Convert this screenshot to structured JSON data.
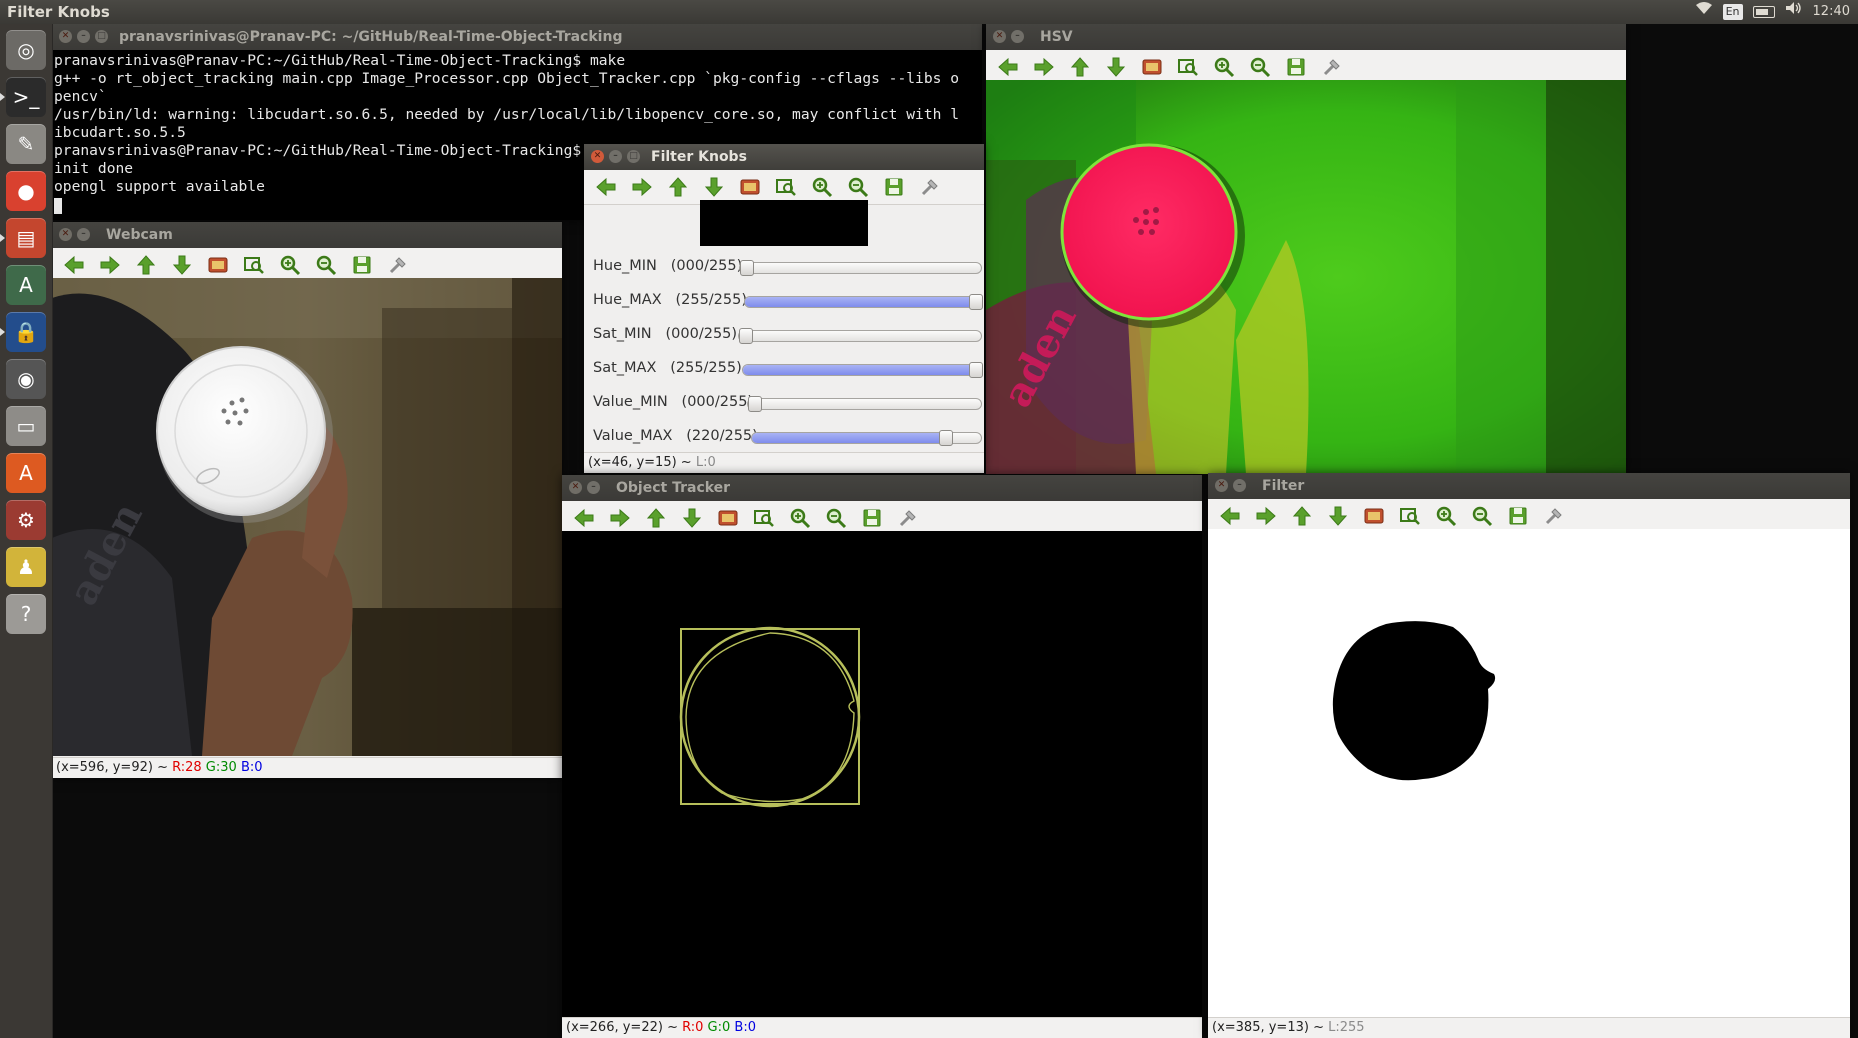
{
  "top_panel": {
    "app_title": "Filter Knobs",
    "keyboard_layout": "En",
    "clock": "12:40"
  },
  "launcher": {
    "items": [
      {
        "name": "dash-home",
        "glyph": "◎",
        "color": "#6c6a66"
      },
      {
        "name": "terminal",
        "glyph": ">_",
        "color": "#2b2b2b"
      },
      {
        "name": "text-editor",
        "glyph": "✎",
        "color": "#8a8883"
      },
      {
        "name": "chrome",
        "glyph": "●",
        "color": "#d9412f"
      },
      {
        "name": "files",
        "glyph": "▤",
        "color": "#c4462e"
      },
      {
        "name": "software-updater",
        "glyph": "A",
        "color": "#3f6a4a"
      },
      {
        "name": "lock-app",
        "glyph": "🔒",
        "color": "#234d8c"
      },
      {
        "name": "webcam-app",
        "glyph": "◉",
        "color": "#555"
      },
      {
        "name": "disk-drive",
        "glyph": "▭",
        "color": "#8e8c88"
      },
      {
        "name": "software-center",
        "glyph": "A",
        "color": "#dd5a21"
      },
      {
        "name": "system-settings",
        "glyph": "⚙",
        "color": "#9b3b32"
      },
      {
        "name": "ninja-ide",
        "glyph": "♟",
        "color": "#d2b43a"
      },
      {
        "name": "help",
        "glyph": "?",
        "color": "#9c9a96"
      }
    ]
  },
  "terminal": {
    "title": "pranavsrinivas@Pranav-PC: ~/GitHub/Real-Time-Object-Tracking",
    "lines": [
      "pranavsrinivas@Pranav-PC:~/GitHub/Real-Time-Object-Tracking$ make",
      "g++ -o rt_object_tracking main.cpp Image_Processor.cpp Object_Tracker.cpp `pkg-config --cflags --libs o",
      "pencv`",
      "/usr/bin/ld: warning: libcudart.so.6.5, needed by /usr/local/lib/libopencv_core.so, may conflict with l",
      "ibcudart.so.5.5",
      "pranavsrinivas@Pranav-PC:~/GitHub/Real-Time-Object-Tracking$ ./rt_object_tracking",
      "init done",
      "opengl support available"
    ]
  },
  "webcam": {
    "title": "Webcam",
    "status_prefix": "(x=596, y=92) ~ ",
    "r": "R:28",
    "g": "G:30",
    "b": "B:0",
    "printed_text": "aden"
  },
  "hsv": {
    "title": "HSV",
    "printed_text": "aden"
  },
  "filter_knobs": {
    "title": "Filter Knobs",
    "knobs": [
      {
        "label": "Hue_MIN",
        "display": "(000/255)",
        "value": 0,
        "max": 255
      },
      {
        "label": "Hue_MAX",
        "display": "(255/255)",
        "value": 255,
        "max": 255
      },
      {
        "label": "Sat_MIN",
        "display": "(000/255)",
        "value": 0,
        "max": 255
      },
      {
        "label": "Sat_MAX",
        "display": "(255/255)",
        "value": 255,
        "max": 255
      },
      {
        "label": "Value_MIN",
        "display": "(000/255)",
        "value": 0,
        "max": 255
      },
      {
        "label": "Value_MAX",
        "display": "(220/255)",
        "value": 220,
        "max": 255
      }
    ],
    "status_prefix": "(x=46, y=15) ~ ",
    "l": "L:0"
  },
  "object_tracker": {
    "title": "Object Tracker",
    "status_prefix": "(x=266, y=22) ~ ",
    "r": "R:0",
    "g": "G:0",
    "b": "B:0",
    "box_color": "#b7bf5b"
  },
  "filter": {
    "title": "Filter",
    "status_prefix": "(x=385, y=13) ~ ",
    "l": "L:255"
  },
  "toolbar_icons": [
    "pan-left-icon",
    "pan-right-icon",
    "pan-up-icon",
    "pan-down-icon",
    "zoom-to-fit-icon",
    "zoom-to-100-icon",
    "zoom-in-icon",
    "zoom-out-icon",
    "save-icon",
    "properties-icon"
  ]
}
